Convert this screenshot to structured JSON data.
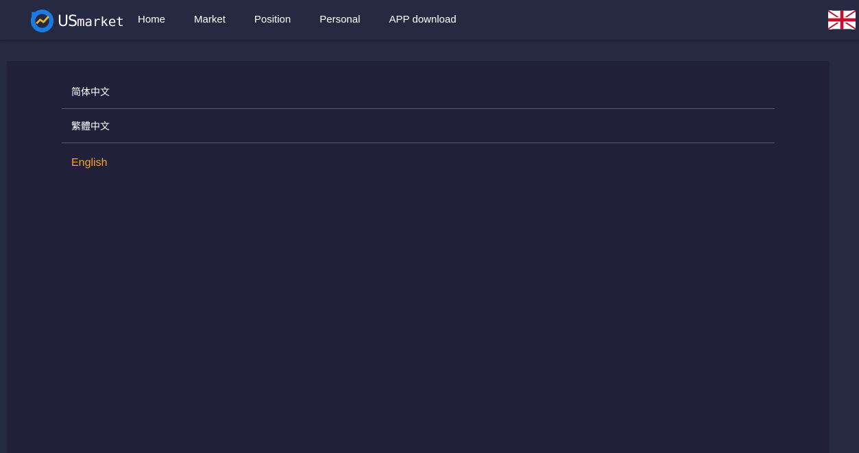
{
  "header": {
    "logo_text_prefix": "US",
    "logo_text_suffix": "market",
    "nav": [
      "Home",
      "Market",
      "Position",
      "Personal",
      "APP download"
    ],
    "flag_icon": "uk-flag-icon"
  },
  "languages": {
    "items": [
      "简体中文",
      "繁體中文",
      "English"
    ],
    "active": "English",
    "active_color": "#f7a51c"
  }
}
